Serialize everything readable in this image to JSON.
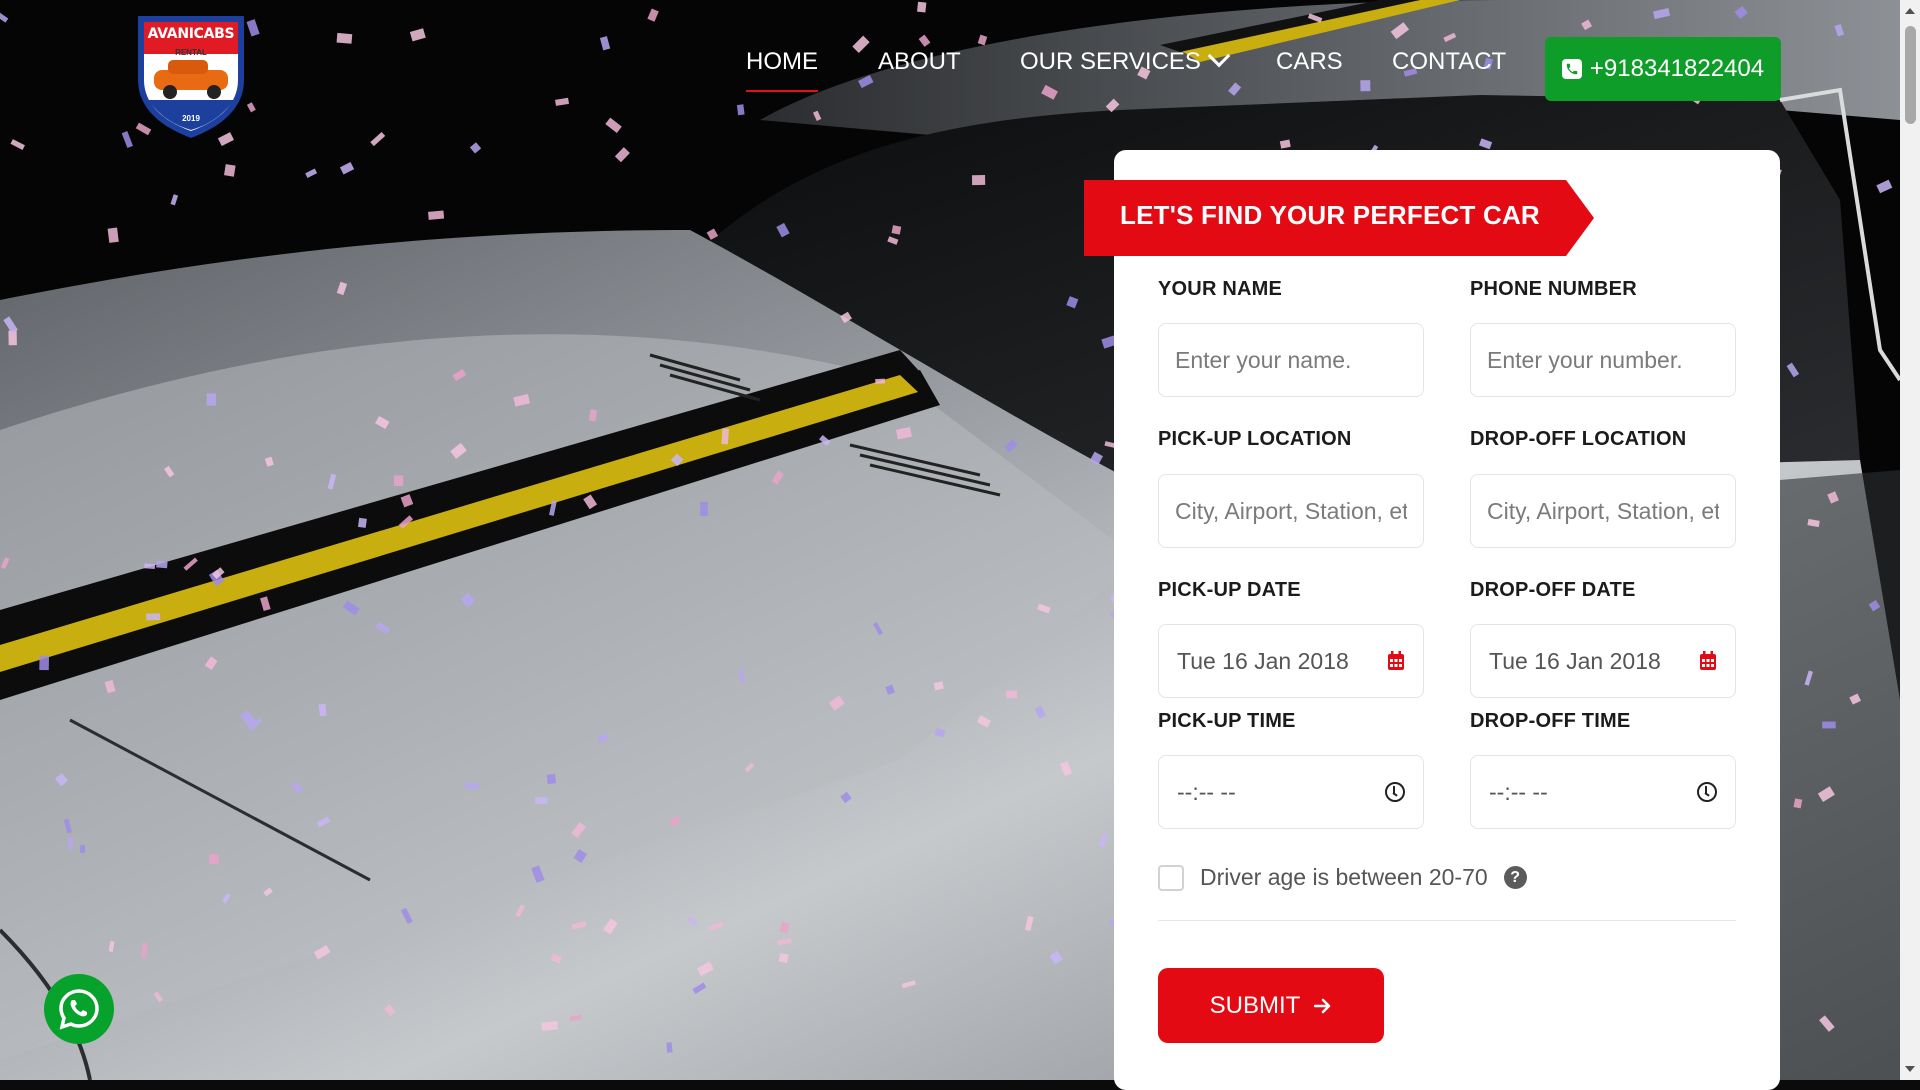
{
  "brand": {
    "name": "AVANICABS",
    "tagline": "RENTAL",
    "year": "2019"
  },
  "nav": {
    "items": [
      {
        "label": "HOME",
        "active": true
      },
      {
        "label": "ABOUT"
      },
      {
        "label": "OUR SERVICES"
      },
      {
        "label": "CARS"
      },
      {
        "label": "CONTACT"
      }
    ],
    "phone": "+918341822404"
  },
  "form": {
    "title": "LET'S FIND YOUR PERFECT CAR",
    "name": {
      "label": "YOUR NAME",
      "placeholder": "Enter your name."
    },
    "phone": {
      "label": "PHONE NUMBER",
      "placeholder": "Enter your number."
    },
    "pickup_location": {
      "label": "PICK-UP LOCATION",
      "placeholder": "City, Airport, Station, etc"
    },
    "dropoff_location": {
      "label": "DROP-OFF LOCATION",
      "placeholder": "City, Airport, Station, etc"
    },
    "pickup_date": {
      "label": "PICK-UP DATE",
      "value": "Tue 16 Jan 2018"
    },
    "dropoff_date": {
      "label": "DROP-OFF DATE",
      "value": "Tue 16 Jan 2018"
    },
    "pickup_time": {
      "label": "PICK-UP TIME",
      "value": "--:-- --"
    },
    "dropoff_time": {
      "label": "DROP-OFF TIME",
      "value": "--:-- --"
    },
    "age_check": {
      "label": "Driver age is between 20-70",
      "checked": false,
      "help": "?"
    },
    "submit": "SUBMIT",
    "submit_icon": "arrow-right"
  },
  "colors": {
    "accent_red": "#e30a14",
    "whatsapp_green": "#06a22b",
    "phone_green": "#0f9d2a"
  },
  "icons": [
    "phone-icon",
    "calendar-icon",
    "clock-icon",
    "help-icon",
    "arrow-right-icon",
    "whatsapp-icon",
    "chevron-down-icon"
  ]
}
